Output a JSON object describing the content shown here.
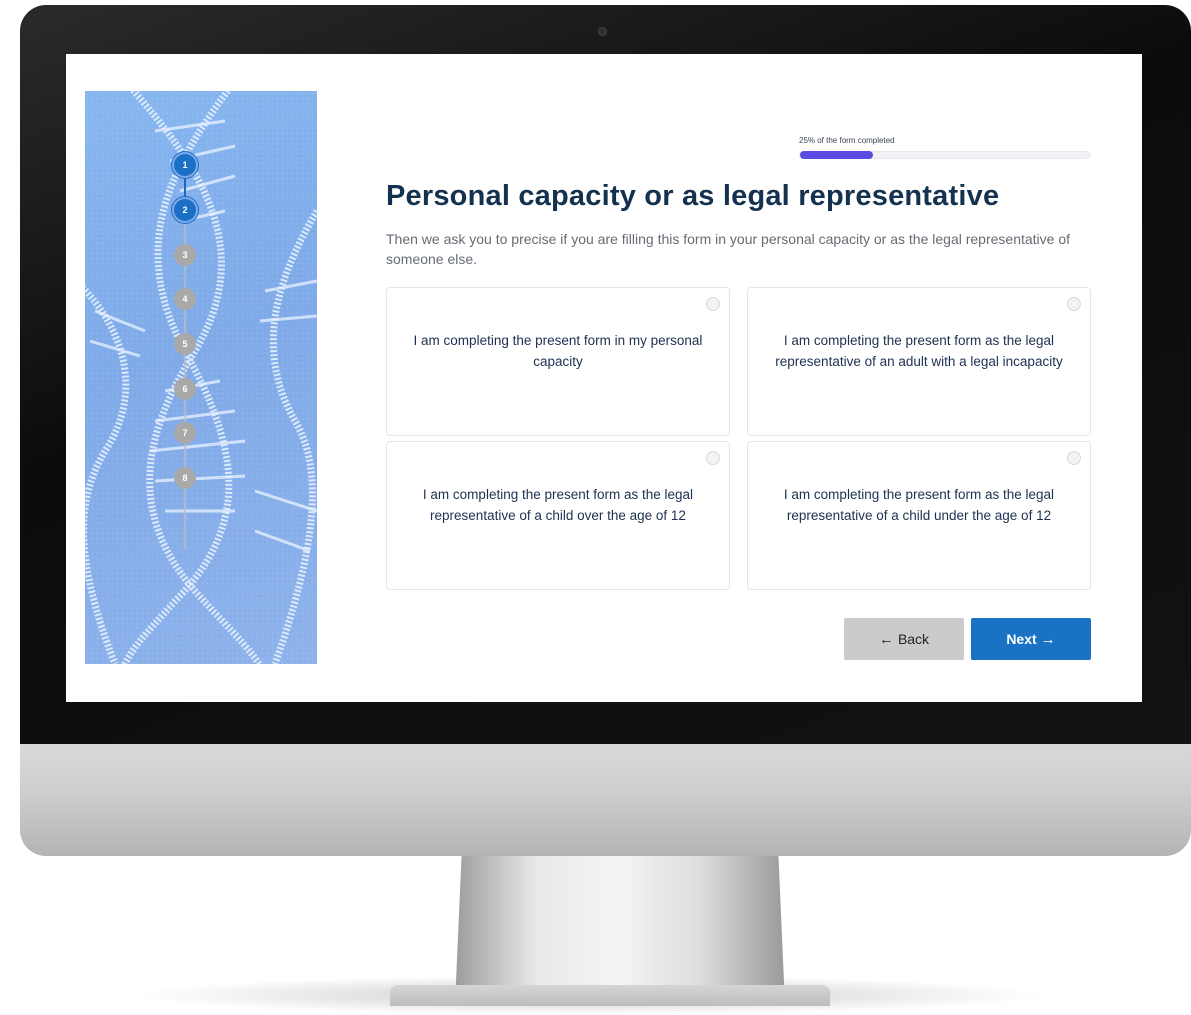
{
  "stepper": {
    "steps": [
      {
        "label": "1",
        "state": "active"
      },
      {
        "label": "2",
        "state": "active"
      },
      {
        "label": "3",
        "state": "pending"
      },
      {
        "label": "4",
        "state": "pending"
      },
      {
        "label": "5",
        "state": "pending"
      },
      {
        "label": "6",
        "state": "pending"
      },
      {
        "label": "7",
        "state": "pending"
      },
      {
        "label": "8",
        "state": "pending"
      }
    ]
  },
  "progress": {
    "label": "25% of the form completed",
    "percent": 25
  },
  "form": {
    "title": "Personal capacity or as legal representative",
    "subtitle": "Then we ask you to precise if you are filling this form in your personal capacity or as the legal representative of someone else.",
    "options": [
      {
        "label": "I am completing the present form in my personal capacity",
        "selected": false
      },
      {
        "label": "I am completing the present form as the legal representative of an adult with a legal incapacity",
        "selected": false
      },
      {
        "label": "I am completing the present form as the legal representative of a child over the age of 12",
        "selected": false
      },
      {
        "label": "I am completing the present form as the legal representative of a child under the age of 12",
        "selected": false
      }
    ]
  },
  "buttons": {
    "back": {
      "label": "Back",
      "icon": "arrow-left-icon"
    },
    "next": {
      "label": "Next",
      "icon": "arrow-right-icon"
    }
  },
  "colors": {
    "accent": "#1a72c4",
    "title": "#14324f",
    "progress": "#5a4be3",
    "step_active": "#1b6fc4",
    "step_pending": "#a9a9a9",
    "panel": "#86b6f0"
  }
}
